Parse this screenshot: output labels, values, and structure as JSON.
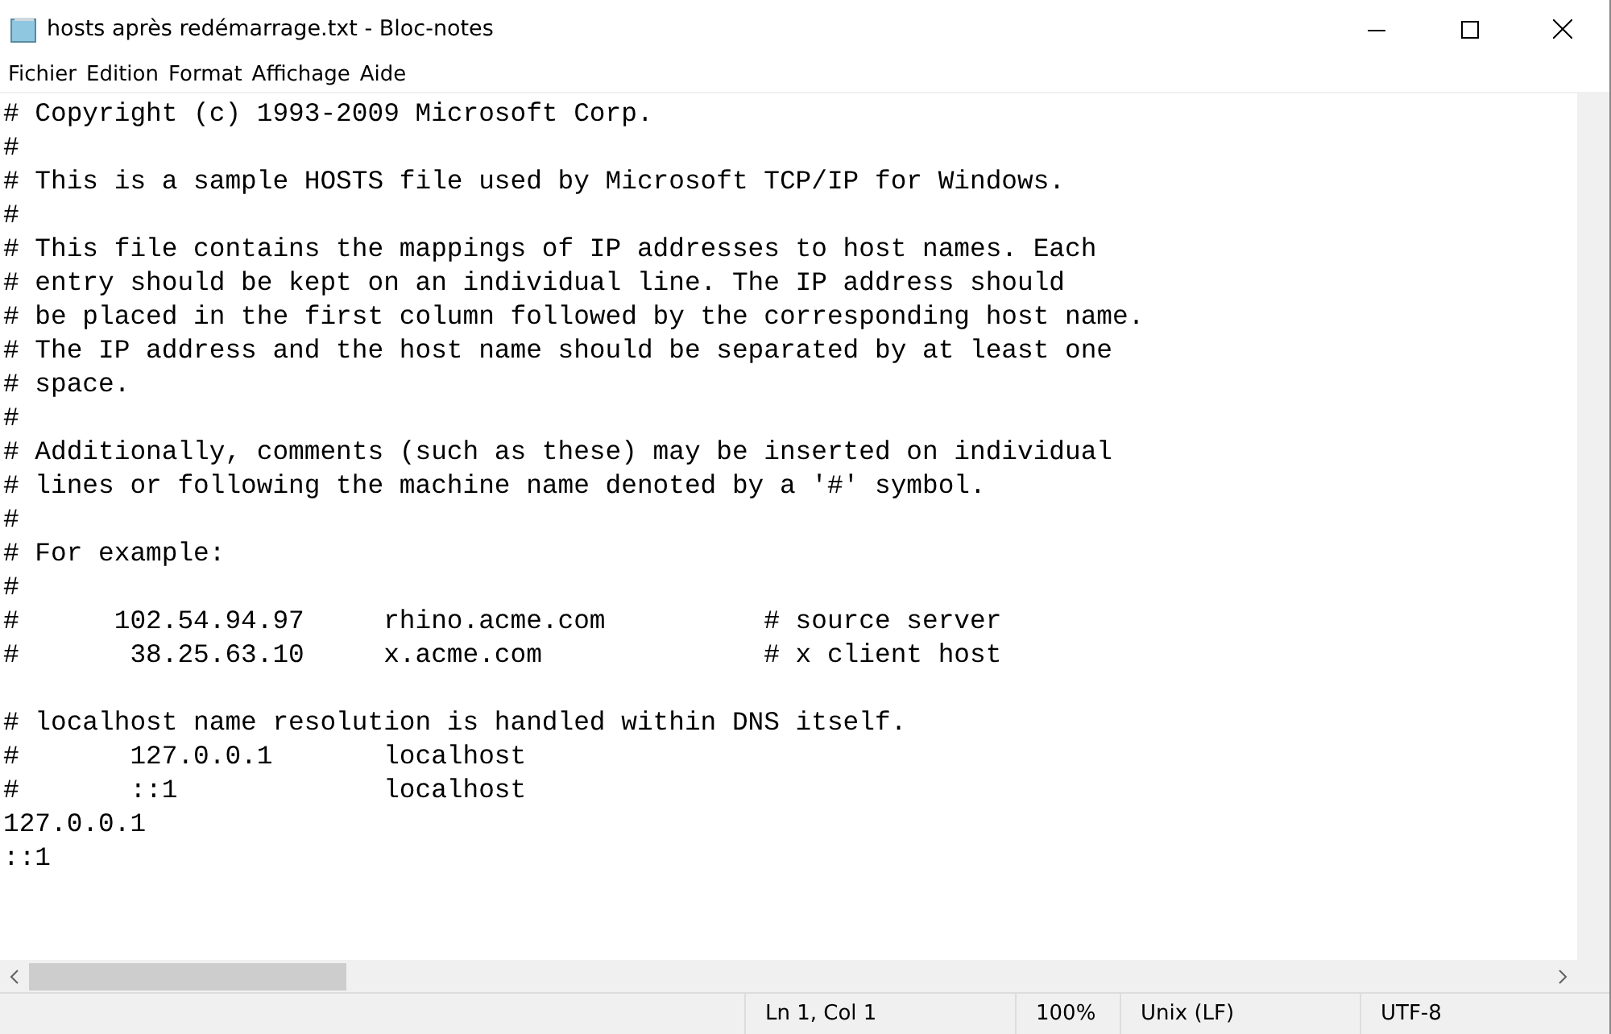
{
  "window": {
    "title": "hosts après redémarrage.txt - Bloc-notes"
  },
  "menu": [
    "Fichier",
    "Edition",
    "Format",
    "Affichage",
    "Aide"
  ],
  "editor": {
    "lines": [
      {
        "kind": "text",
        "text": "# Copyright (c) 1993-2009 Microsoft Corp."
      },
      {
        "kind": "text",
        "text": "#"
      },
      {
        "kind": "text",
        "text": "# This is a sample HOSTS file used by Microsoft TCP/IP for Windows."
      },
      {
        "kind": "text",
        "text": "#"
      },
      {
        "kind": "text",
        "text": "# This file contains the mappings of IP addresses to host names. Each"
      },
      {
        "kind": "text",
        "text": "# entry should be kept on an individual line. The IP address should"
      },
      {
        "kind": "text",
        "text": "# be placed in the first column followed by the corresponding host name."
      },
      {
        "kind": "text",
        "text": "# The IP address and the host name should be separated by at least one"
      },
      {
        "kind": "text",
        "text": "# space."
      },
      {
        "kind": "text",
        "text": "#"
      },
      {
        "kind": "text",
        "text": "# Additionally, comments (such as these) may be inserted on individual"
      },
      {
        "kind": "text",
        "text": "# lines or following the machine name denoted by a '#' symbol."
      },
      {
        "kind": "text",
        "text": "#"
      },
      {
        "kind": "text",
        "text": "# For example:"
      },
      {
        "kind": "text",
        "text": "#"
      },
      {
        "kind": "text",
        "text": "#      102.54.94.97     rhino.acme.com          # source server"
      },
      {
        "kind": "text",
        "text": "#       38.25.63.10     x.acme.com              # x client host"
      },
      {
        "kind": "blank"
      },
      {
        "kind": "text",
        "text": "# localhost name resolution is handled within DNS itself."
      },
      {
        "kind": "text",
        "text": "#       127.0.0.1       localhost"
      },
      {
        "kind": "text",
        "text": "#       ::1             localhost"
      },
      {
        "kind": "text",
        "text": "127.0.0.1"
      },
      {
        "kind": "text",
        "text": "::1"
      }
    ]
  },
  "status_bar": {
    "position": "Ln 1, Col 1",
    "zoom": "100%",
    "line_ending": "Unix (LF)",
    "encoding": "UTF-8"
  }
}
